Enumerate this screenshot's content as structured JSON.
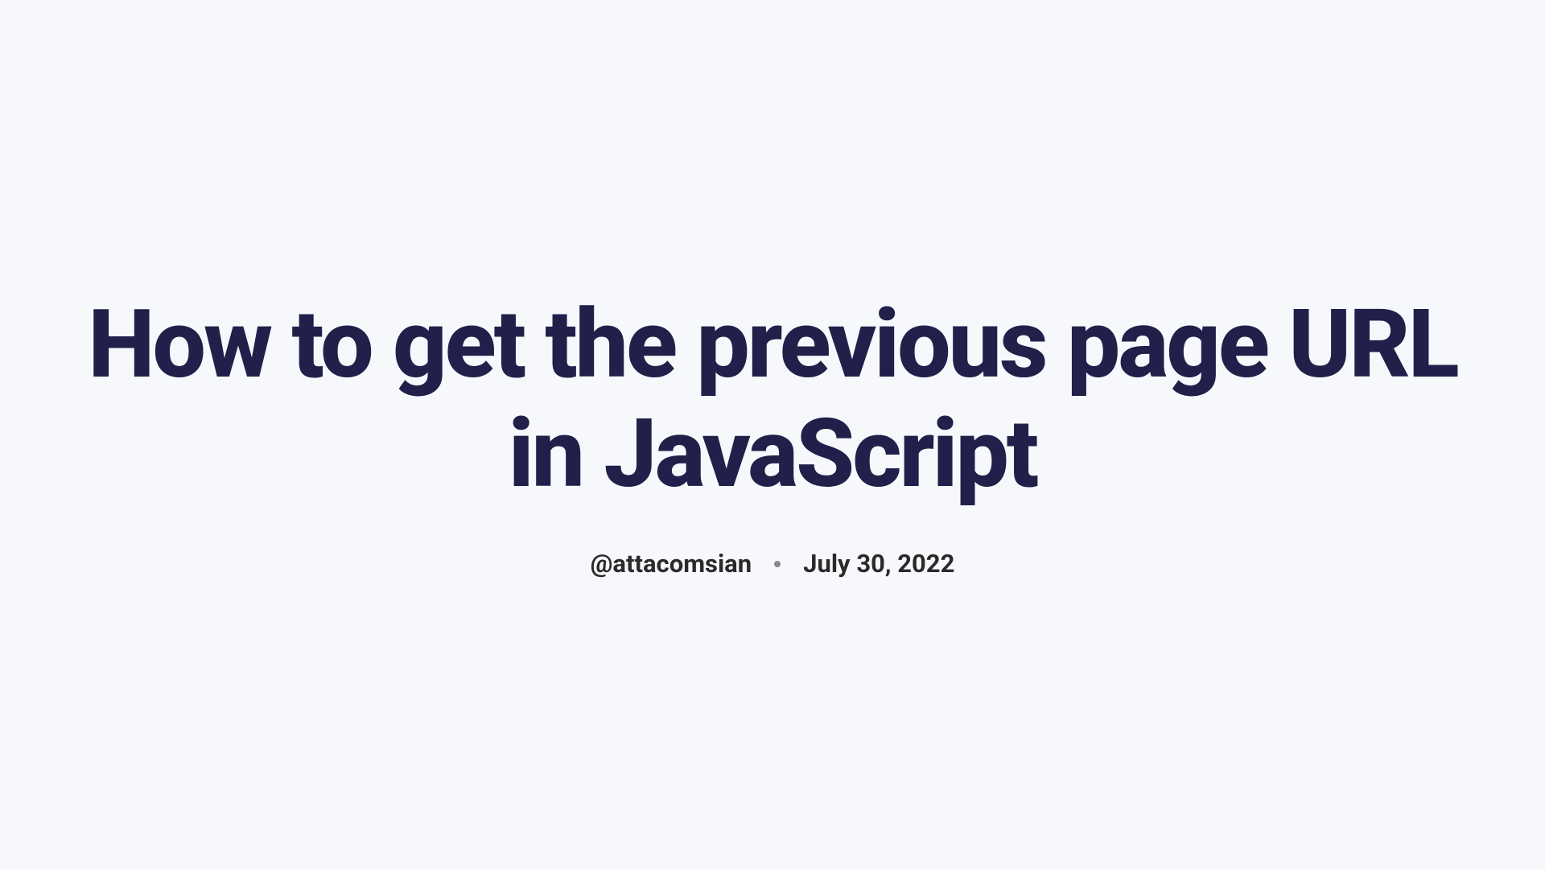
{
  "article": {
    "title": "How to get the previous page URL in JavaScript",
    "author": "@attacomsian",
    "date": "July 30, 2022"
  }
}
